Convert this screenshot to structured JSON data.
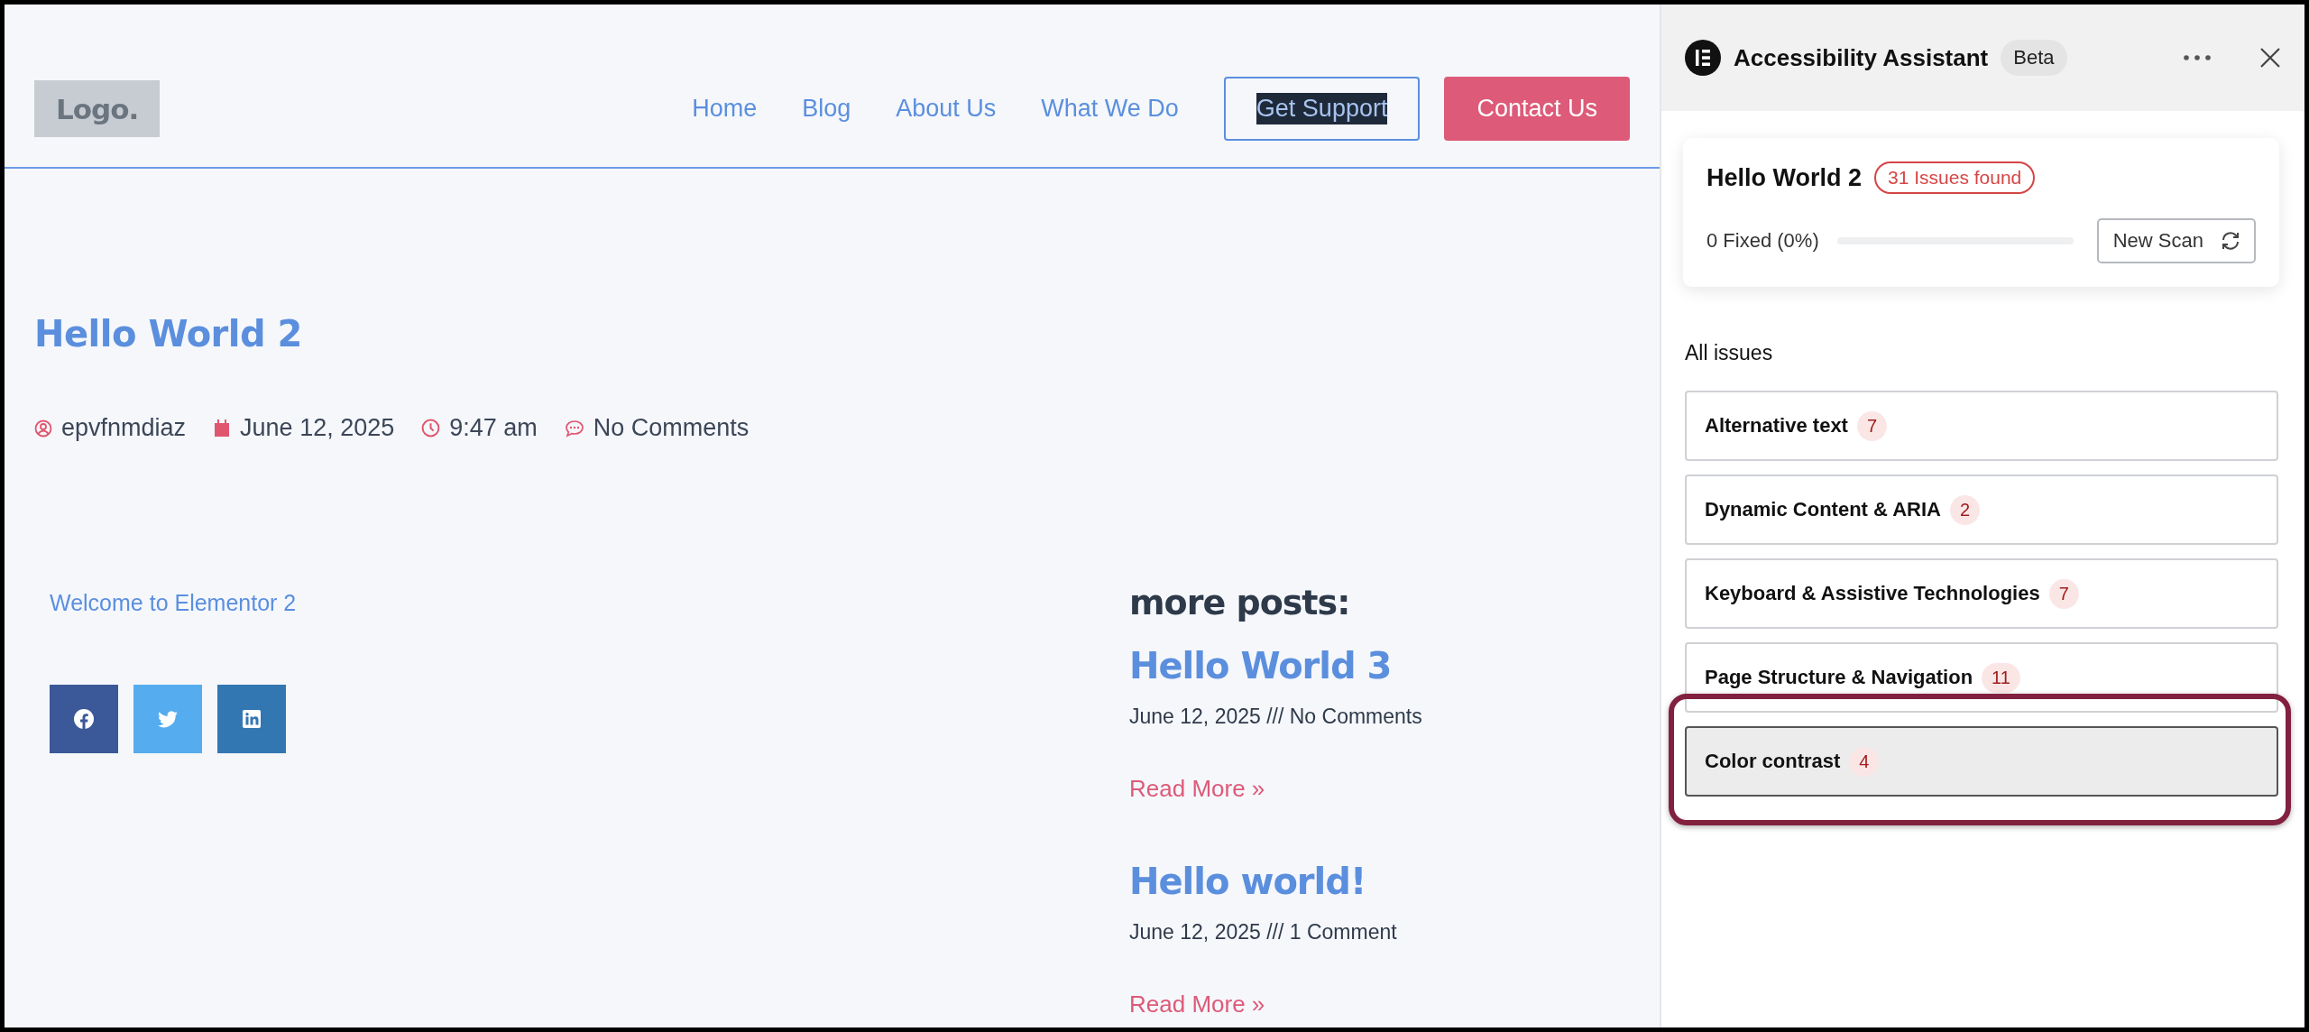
{
  "site": {
    "logo": "Logo.",
    "nav": [
      {
        "label": "Home",
        "kind": "link"
      },
      {
        "label": "Blog",
        "kind": "link"
      },
      {
        "label": "About Us",
        "kind": "link"
      },
      {
        "label": "What We Do",
        "kind": "link"
      },
      {
        "label": "Get Support",
        "kind": "outline",
        "text_selected": true
      },
      {
        "label": "Contact Us",
        "kind": "filled",
        "text_selected": false
      }
    ],
    "post": {
      "title": "Hello World 2",
      "meta": [
        {
          "kind": "author",
          "text": "epvfnmdiaz"
        },
        {
          "kind": "date",
          "text": "June 12, 2025"
        },
        {
          "kind": "time",
          "text": "9:47 am"
        },
        {
          "kind": "comments",
          "text": "No Comments"
        }
      ],
      "body": "Welcome to Elementor 2",
      "share": [
        {
          "kind": "facebook"
        },
        {
          "kind": "twitter"
        },
        {
          "kind": "linkedin"
        }
      ]
    },
    "more_posts": {
      "heading": "more posts:",
      "posts": [
        {
          "title": "Hello World 3",
          "meta": "June 12, 2025 /// No Comments",
          "read_more": "Read More »"
        },
        {
          "title": "Hello world!",
          "meta": "June 12, 2025 /// 1 Comment",
          "read_more": "Read More »"
        }
      ]
    }
  },
  "panel": {
    "title": "Accessibility Assistant",
    "badge": "Beta",
    "scan": {
      "page": "Hello World 2",
      "issues": "31 Issues found",
      "fixed": "0 Fixed (0%)",
      "level": 0,
      "button": "New Scan"
    },
    "list_title": "All issues",
    "issues": [
      {
        "label": "Alternative text",
        "count": "7",
        "selected": false,
        "highlighted": false
      },
      {
        "label": "Dynamic Content & ARIA",
        "count": "2",
        "selected": false,
        "highlighted": false
      },
      {
        "label": "Keyboard & Assistive Technologies",
        "count": "7",
        "selected": false,
        "highlighted": false
      },
      {
        "label": "Page Structure & Navigation",
        "count": "11",
        "selected": false,
        "highlighted": false
      },
      {
        "label": "Color contrast",
        "count": "4",
        "selected": true,
        "highlighted": true
      }
    ]
  }
}
